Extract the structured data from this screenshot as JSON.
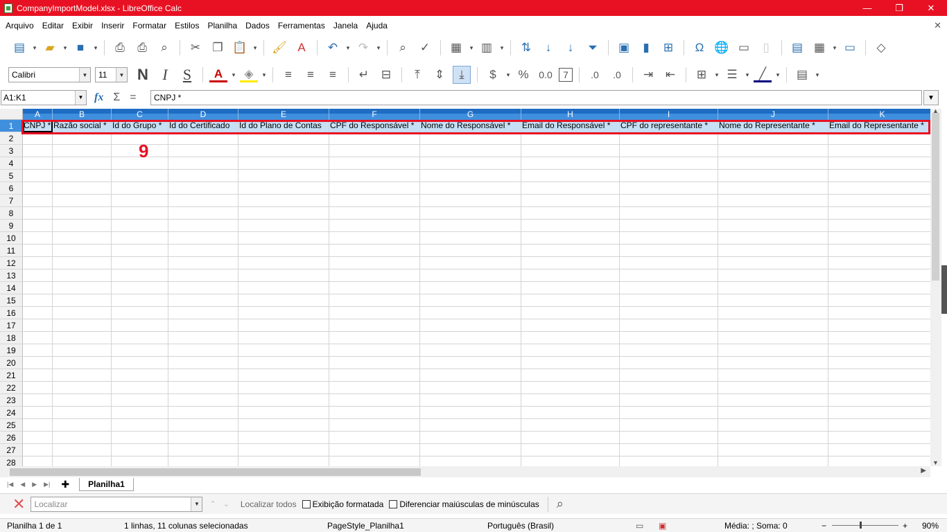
{
  "window": {
    "title": "CompanyImportModel.xlsx - LibreOffice Calc",
    "controls": [
      "—",
      "❐",
      "✕"
    ]
  },
  "menu": [
    "Arquivo",
    "Editar",
    "Exibir",
    "Inserir",
    "Formatar",
    "Estilos",
    "Planilha",
    "Dados",
    "Ferramentas",
    "Janela",
    "Ajuda"
  ],
  "format_toolbar": {
    "font_name": "Calibri",
    "font_size": "11",
    "bold_glyph": "N",
    "italic_glyph": "I",
    "underline_glyph": "S"
  },
  "formula_bar": {
    "name_box": "A1:K1",
    "content": "CNPJ *"
  },
  "columns": [
    "A",
    "B",
    "C",
    "D",
    "E",
    "F",
    "G",
    "H",
    "I",
    "J",
    "K"
  ],
  "header_row": [
    "CNPJ *",
    "Razão social *",
    "Id do Grupo *",
    "Id do Certificado",
    "Id do Plano de Contas",
    "CPF do Responsável *",
    "Nome do Responsável *",
    "Email do Responsável *",
    "CPF do representante *",
    "Nome do Representante *",
    "Email do Representante *"
  ],
  "row_numbers": [
    "1",
    "2",
    "3",
    "4",
    "5",
    "6",
    "7",
    "8",
    "9",
    "10",
    "11",
    "12",
    "13",
    "14",
    "15",
    "16",
    "17",
    "18",
    "19",
    "20",
    "21",
    "22",
    "23",
    "24",
    "25",
    "26",
    "27",
    "28"
  ],
  "annotation": "9",
  "sheet_tabs": {
    "add_symbol": "✚",
    "active": "Planilha1"
  },
  "find_bar": {
    "placeholder": "Localizar",
    "find_all": "Localizar todos",
    "formatted_display": "Exibição formatada",
    "match_case": "Diferenciar maiúsculas de minúsculas"
  },
  "status_bar": {
    "sheet": "Planilha 1 de 1",
    "selection": "1 linhas, 11 colunas selecionadas",
    "page_style": "PageStyle_Planilha1",
    "language": "Português (Brasil)",
    "sum": "Média: ; Soma: 0",
    "zoom": "90%"
  },
  "colors": {
    "title_bar": "#e81123",
    "selection_header": "#3f8fdf",
    "selected_cells": "#c6dff5",
    "highlight_box": "#e81123"
  }
}
